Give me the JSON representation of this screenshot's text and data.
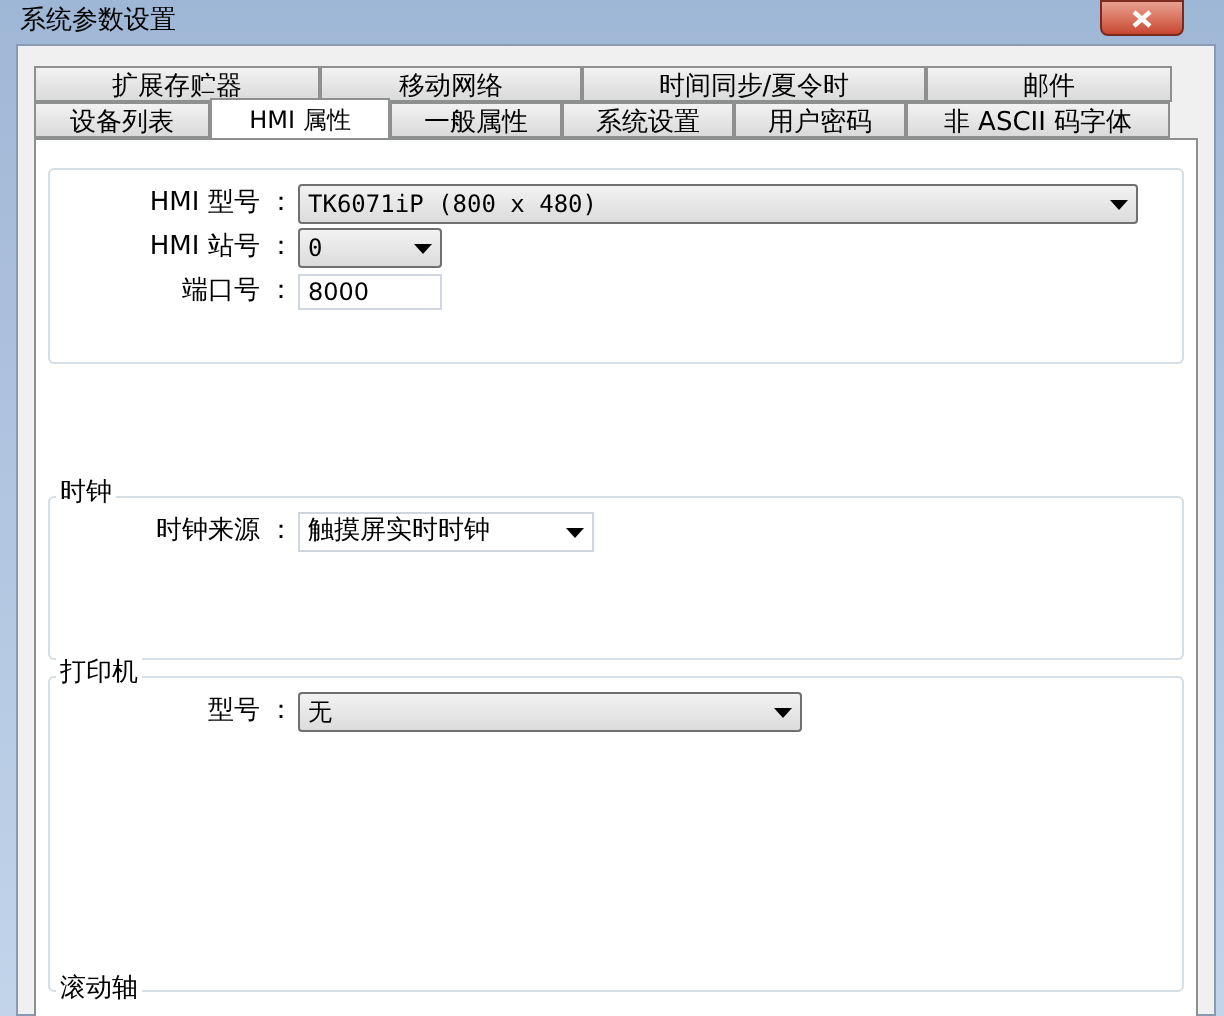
{
  "window": {
    "title": "系统参数设置"
  },
  "tab_rows": [
    [
      {
        "label": "扩展存贮器",
        "selected": false
      },
      {
        "label": "移动网络",
        "selected": false
      },
      {
        "label": "时间同步/夏令时",
        "selected": false
      },
      {
        "label": "邮件",
        "selected": false
      }
    ],
    [
      {
        "label": "设备列表",
        "selected": false
      },
      {
        "label": "HMI 属性",
        "selected": true
      },
      {
        "label": "一般属性",
        "selected": false
      },
      {
        "label": "系统设置",
        "selected": false
      },
      {
        "label": "用户密码",
        "selected": false
      },
      {
        "label": "非 ASCII 码字体",
        "selected": false
      }
    ]
  ],
  "groups": [
    {
      "fields": [
        {
          "label": "HMI 型号 ：",
          "kind": "dropdown",
          "value": "TK6071iP (800 x 480)"
        },
        {
          "label": "HMI 站号 ：",
          "kind": "dropdown",
          "value": "0"
        },
        {
          "label": "端口号 ：",
          "kind": "input",
          "value": "8000"
        }
      ]
    },
    {
      "title": "时钟",
      "fields": [
        {
          "label": "时钟来源 ：",
          "kind": "combo",
          "value": "触摸屏实时时钟"
        }
      ]
    },
    {
      "title": "打印机",
      "fields": [
        {
          "label": "型号 ：",
          "kind": "dropdown",
          "value": "无"
        }
      ]
    },
    {
      "title": "滚动轴"
    }
  ]
}
